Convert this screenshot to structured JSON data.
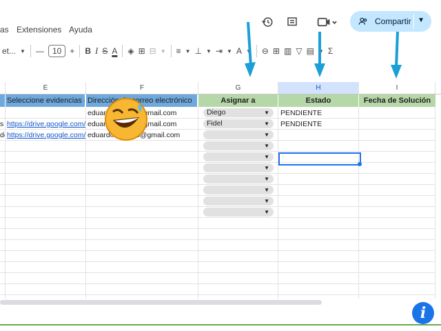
{
  "menu": {
    "items": [
      "as",
      "Extensiones",
      "Ayuda"
    ]
  },
  "header": {
    "share_label": "Compartir"
  },
  "toolbar": {
    "font_name": "et...",
    "font_size": "10",
    "minus": "—",
    "plus": "+",
    "bold": "B",
    "italic": "I",
    "strike": "S",
    "textcolor": "A",
    "sigma": "Σ"
  },
  "columns": [
    "E",
    "F",
    "G",
    "H",
    "I"
  ],
  "headers": {
    "e": "Seleccione evidencias (o",
    "f": "Dirección de correo electrónico",
    "g": "Asignar a",
    "h": "Estado",
    "i": "Fecha de Solución"
  },
  "rows": [
    {
      "d": "",
      "e": "",
      "f": "eduar",
      "f2": "@gmail.com",
      "g": "Diego",
      "h": "PENDIENTE"
    },
    {
      "d": "s",
      "e": "https://drive.google.com/",
      "f": "eduar",
      "f2": "@gmail.com",
      "g": "Fidel",
      "h": "PENDIENTE"
    },
    {
      "d": "de",
      "e": "https://drive.google.com/",
      "f": "eduardo",
      "f2": "c@gmail.com",
      "g": "",
      "h": ""
    }
  ],
  "empty_dropdowns": 7,
  "colors": {
    "accent": "#1a73e8",
    "header_blue": "#6fa8dc",
    "header_green": "#b6d7a8",
    "share_bg": "#c2e7ff",
    "arrow": "#1a9fd6"
  }
}
